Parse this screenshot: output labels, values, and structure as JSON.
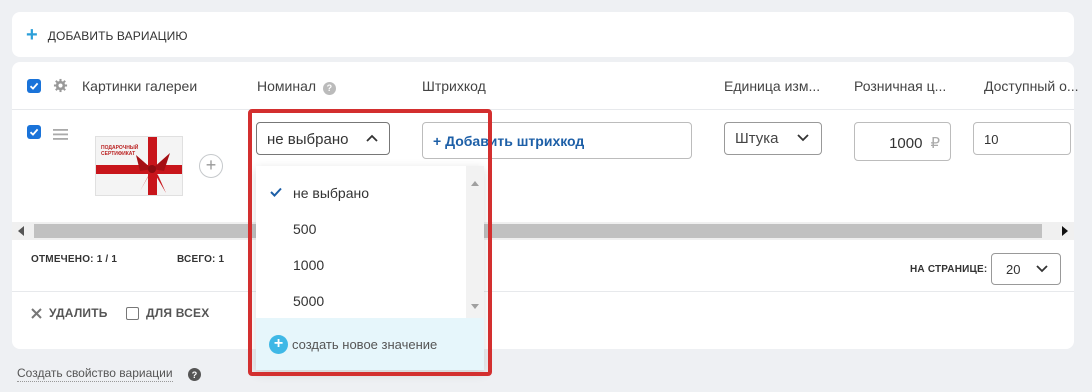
{
  "top": {
    "add_variation": "ДОБАВИТЬ ВАРИАЦИЮ"
  },
  "table": {
    "headers": {
      "gallery": "Картинки галереи",
      "nominal": "Номинал",
      "barcode": "Штрихкод",
      "unit": "Единица изм...",
      "price": "Розничная ц...",
      "available": "Доступный о..."
    },
    "row": {
      "nominal_value": "не выбрано",
      "barcode_button": "+ Добавить штрихкод",
      "unit_value": "Штука",
      "price_value": "1000",
      "currency": "₽",
      "available_value": "10",
      "thumb_text": "ПОДАРОЧНЫЙ СЕРТИФИКАТ"
    }
  },
  "footer": {
    "marked": "ОТМЕЧЕНО: 1 / 1",
    "total": "ВСЕГО: 1",
    "per_page_label": "НА СТРАНИЦЕ:",
    "per_page_value": "20",
    "delete": "УДАЛИТЬ",
    "for_all": "ДЛЯ ВСЕХ"
  },
  "create_property": "Создать свойство вариации",
  "dropdown": {
    "items": [
      "не выбрано",
      "500",
      "1000",
      "5000"
    ],
    "selected_index": 0,
    "create_new": "создать новое значение"
  },
  "colors": {
    "accent": "#1a73d9",
    "highlight": "#d32f2f",
    "create_bg": "#e6f6fb"
  }
}
